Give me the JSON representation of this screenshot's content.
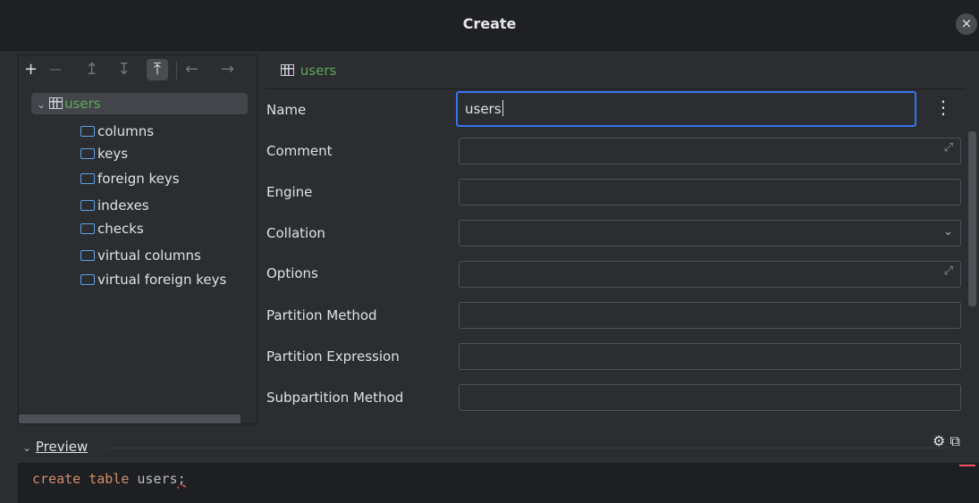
{
  "dialog": {
    "title": "Create",
    "close_icon": "close-icon"
  },
  "tree_toolbar": {
    "add": "+",
    "remove": "—",
    "move_up": "↥",
    "move_down": "↧",
    "move_top": "⤒",
    "back": "←",
    "forward": "→"
  },
  "tree": {
    "root": {
      "label": "users",
      "icon": "table-icon"
    },
    "children": [
      {
        "label": "columns"
      },
      {
        "label": "keys"
      },
      {
        "label": "foreign keys"
      },
      {
        "label": "indexes"
      },
      {
        "label": "checks"
      },
      {
        "label": "virtual columns"
      },
      {
        "label": "virtual foreign keys"
      }
    ]
  },
  "form": {
    "header": "users",
    "fields": {
      "name": {
        "label": "Name",
        "value": "users"
      },
      "comment": {
        "label": "Comment",
        "value": ""
      },
      "engine": {
        "label": "Engine",
        "value": ""
      },
      "collation": {
        "label": "Collation",
        "value": ""
      },
      "options": {
        "label": "Options",
        "value": ""
      },
      "partition_method": {
        "label": "Partition Method",
        "value": ""
      },
      "partition_expression": {
        "label": "Partition Expression",
        "value": ""
      },
      "subpartition_method": {
        "label": "Subpartition Method",
        "value": ""
      }
    }
  },
  "preview": {
    "toggle_label": "Preview",
    "code": {
      "kw1": "create",
      "kw2": "table",
      "ident": "users",
      "semi": ";"
    }
  },
  "colors": {
    "accent": "#3574f0",
    "green": "#5ea85c",
    "folder": "#5fa0e8",
    "keyword": "#cf8e6d",
    "error": "#f75464"
  }
}
